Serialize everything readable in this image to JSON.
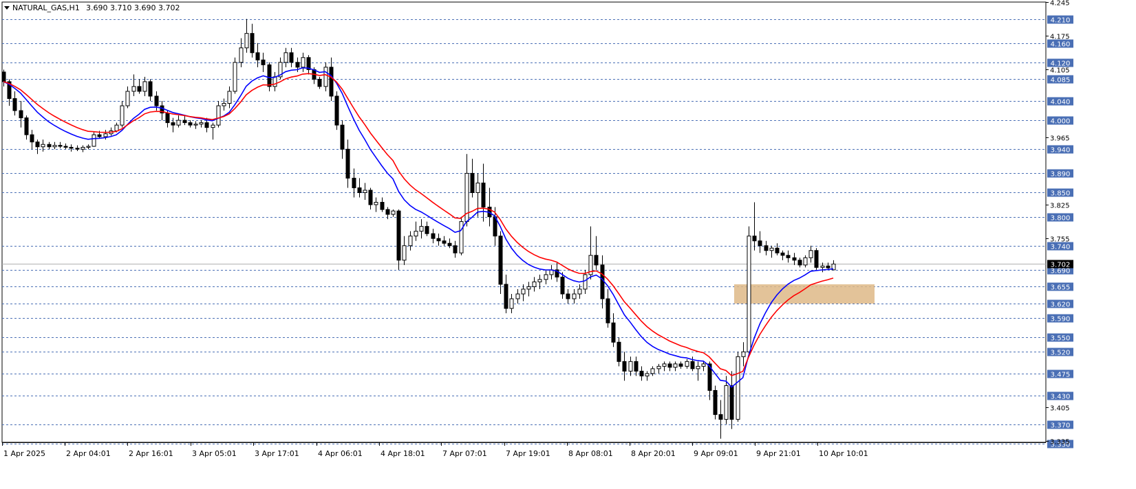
{
  "chart_data": {
    "type": "candlestick",
    "header": {
      "symbol": "NATURAL_GAS,H1",
      "ohlc": "3.690 3.710 3.690 3.702"
    },
    "current_price": "3.702",
    "y_ticks": [
      "4.245",
      "4.175",
      "4.105",
      "3.965",
      "3.825",
      "3.755",
      "3.405",
      "3.335"
    ],
    "level_lines": [
      "4.210",
      "4.160",
      "4.120",
      "4.085",
      "4.040",
      "4.000",
      "3.940",
      "3.890",
      "3.850",
      "3.800",
      "3.740",
      "3.690",
      "3.655",
      "3.620",
      "3.590",
      "3.550",
      "3.520",
      "3.475",
      "3.430",
      "3.370",
      "3.330"
    ],
    "x_labels": [
      "1 Apr 2025",
      "2 Apr 04:01",
      "2 Apr 16:01",
      "3 Apr 05:01",
      "3 Apr 17:01",
      "4 Apr 06:01",
      "4 Apr 18:01",
      "7 Apr 07:01",
      "7 Apr 19:01",
      "8 Apr 08:01",
      "8 Apr 20:01",
      "9 Apr 09:01",
      "9 Apr 21:01",
      "10 Apr 10:01"
    ],
    "zone": {
      "low": 3.62,
      "high": 3.66,
      "color": "#deb887"
    },
    "colors": {
      "blue_ma": "#0000ff",
      "red_ma": "#ff0000",
      "grid": "#4a6fb5",
      "candle": "#000000"
    },
    "ohlc_series": [
      [
        4.1,
        4.105,
        4.07,
        4.08
      ],
      [
        4.08,
        4.085,
        4.03,
        4.045
      ],
      [
        4.045,
        4.06,
        4.01,
        4.02
      ],
      [
        4.02,
        4.04,
        3.985,
        4.005
      ],
      [
        4.005,
        4.01,
        3.96,
        3.97
      ],
      [
        3.97,
        3.98,
        3.94,
        3.955
      ],
      [
        3.955,
        3.96,
        3.93,
        3.945
      ],
      [
        3.945,
        3.96,
        3.935,
        3.95
      ],
      [
        3.95,
        3.955,
        3.94,
        3.945
      ],
      [
        3.945,
        3.955,
        3.94,
        3.948
      ],
      [
        3.948,
        3.955,
        3.942,
        3.946
      ],
      [
        3.946,
        3.952,
        3.94,
        3.944
      ],
      [
        3.944,
        3.95,
        3.935,
        3.942
      ],
      [
        3.942,
        3.948,
        3.936,
        3.94
      ],
      [
        3.94,
        3.948,
        3.934,
        3.944
      ],
      [
        3.944,
        3.95,
        3.94,
        3.946
      ],
      [
        3.946,
        3.975,
        3.945,
        3.97
      ],
      [
        3.97,
        3.978,
        3.962,
        3.966
      ],
      [
        3.966,
        3.98,
        3.96,
        3.972
      ],
      [
        3.972,
        3.985,
        3.968,
        3.978
      ],
      [
        3.978,
        3.995,
        3.975,
        3.99
      ],
      [
        3.99,
        4.04,
        3.985,
        4.03
      ],
      [
        4.03,
        4.07,
        4.025,
        4.06
      ],
      [
        4.06,
        4.095,
        4.05,
        4.07
      ],
      [
        4.07,
        4.085,
        4.055,
        4.06
      ],
      [
        4.06,
        4.09,
        4.05,
        4.08
      ],
      [
        4.08,
        4.085,
        4.04,
        4.05
      ],
      [
        4.05,
        4.06,
        4.02,
        4.03
      ],
      [
        4.03,
        4.04,
        4.0,
        4.015
      ],
      [
        4.015,
        4.02,
        3.985,
        3.995
      ],
      [
        3.995,
        4.005,
        3.975,
        3.99
      ],
      [
        3.99,
        4.01,
        3.985,
        4.0
      ],
      [
        4.0,
        4.01,
        3.99,
        3.995
      ],
      [
        3.995,
        4.0,
        3.985,
        3.99
      ],
      [
        3.99,
        3.998,
        3.982,
        3.992
      ],
      [
        3.992,
        4.0,
        3.985,
        3.995
      ],
      [
        3.995,
        4.005,
        3.975,
        3.985
      ],
      [
        3.985,
        3.995,
        3.96,
        3.99
      ],
      [
        3.99,
        4.04,
        3.985,
        4.03
      ],
      [
        4.03,
        4.045,
        4.02,
        4.035
      ],
      [
        4.035,
        4.07,
        4.025,
        4.06
      ],
      [
        4.06,
        4.13,
        4.055,
        4.12
      ],
      [
        4.12,
        4.17,
        4.11,
        4.15
      ],
      [
        4.15,
        4.21,
        4.14,
        4.18
      ],
      [
        4.18,
        4.2,
        4.13,
        4.14
      ],
      [
        4.14,
        4.16,
        4.11,
        4.125
      ],
      [
        4.125,
        4.14,
        4.1,
        4.115
      ],
      [
        4.115,
        4.12,
        4.06,
        4.07
      ],
      [
        4.07,
        4.1,
        4.06,
        4.09
      ],
      [
        4.09,
        4.13,
        4.085,
        4.12
      ],
      [
        4.12,
        4.15,
        4.11,
        4.14
      ],
      [
        4.14,
        4.15,
        4.11,
        4.12
      ],
      [
        4.12,
        4.13,
        4.1,
        4.11
      ],
      [
        4.11,
        4.14,
        4.1,
        4.13
      ],
      [
        4.13,
        4.135,
        4.095,
        4.105
      ],
      [
        4.105,
        4.11,
        4.075,
        4.085
      ],
      [
        4.085,
        4.09,
        4.065,
        4.07
      ],
      [
        4.07,
        4.12,
        4.06,
        4.11
      ],
      [
        4.11,
        4.13,
        4.04,
        4.05
      ],
      [
        4.05,
        4.06,
        3.98,
        3.99
      ],
      [
        3.99,
        4.0,
        3.92,
        3.94
      ],
      [
        3.94,
        3.96,
        3.86,
        3.88
      ],
      [
        3.88,
        3.9,
        3.84,
        3.86
      ],
      [
        3.86,
        3.88,
        3.84,
        3.85
      ],
      [
        3.85,
        3.87,
        3.835,
        3.855
      ],
      [
        3.855,
        3.86,
        3.815,
        3.825
      ],
      [
        3.825,
        3.84,
        3.81,
        3.83
      ],
      [
        3.83,
        3.84,
        3.81,
        3.815
      ],
      [
        3.815,
        3.82,
        3.795,
        3.805
      ],
      [
        3.805,
        3.815,
        3.8,
        3.812
      ],
      [
        3.812,
        3.815,
        3.69,
        3.71
      ],
      [
        3.71,
        3.76,
        3.7,
        3.74
      ],
      [
        3.74,
        3.77,
        3.73,
        3.76
      ],
      [
        3.76,
        3.79,
        3.75,
        3.77
      ],
      [
        3.77,
        3.795,
        3.755,
        3.78
      ],
      [
        3.78,
        3.79,
        3.76,
        3.765
      ],
      [
        3.765,
        3.775,
        3.745,
        3.755
      ],
      [
        3.755,
        3.765,
        3.74,
        3.75
      ],
      [
        3.75,
        3.76,
        3.74,
        3.745
      ],
      [
        3.745,
        3.755,
        3.735,
        3.74
      ],
      [
        3.74,
        3.75,
        3.715,
        3.725
      ],
      [
        3.725,
        3.8,
        3.72,
        3.79
      ],
      [
        3.79,
        3.93,
        3.78,
        3.89
      ],
      [
        3.89,
        3.92,
        3.84,
        3.85
      ],
      [
        3.85,
        3.89,
        3.8,
        3.87
      ],
      [
        3.87,
        3.91,
        3.79,
        3.82
      ],
      [
        3.82,
        3.86,
        3.78,
        3.8
      ],
      [
        3.8,
        3.82,
        3.74,
        3.76
      ],
      [
        3.76,
        3.77,
        3.64,
        3.66
      ],
      [
        3.66,
        3.68,
        3.6,
        3.61
      ],
      [
        3.61,
        3.64,
        3.6,
        3.63
      ],
      [
        3.63,
        3.65,
        3.62,
        3.64
      ],
      [
        3.64,
        3.66,
        3.625,
        3.65
      ],
      [
        3.65,
        3.665,
        3.635,
        3.655
      ],
      [
        3.655,
        3.675,
        3.645,
        3.665
      ],
      [
        3.665,
        3.68,
        3.65,
        3.67
      ],
      [
        3.67,
        3.69,
        3.66,
        3.68
      ],
      [
        3.68,
        3.7,
        3.67,
        3.69
      ],
      [
        3.69,
        3.705,
        3.665,
        3.675
      ],
      [
        3.675,
        3.685,
        3.63,
        3.64
      ],
      [
        3.64,
        3.65,
        3.62,
        3.63
      ],
      [
        3.63,
        3.65,
        3.62,
        3.64
      ],
      [
        3.64,
        3.66,
        3.63,
        3.65
      ],
      [
        3.65,
        3.69,
        3.64,
        3.68
      ],
      [
        3.68,
        3.78,
        3.67,
        3.72
      ],
      [
        3.72,
        3.76,
        3.69,
        3.7
      ],
      [
        3.7,
        3.72,
        3.61,
        3.63
      ],
      [
        3.63,
        3.65,
        3.57,
        3.58
      ],
      [
        3.58,
        3.6,
        3.53,
        3.54
      ],
      [
        3.54,
        3.55,
        3.49,
        3.5
      ],
      [
        3.5,
        3.52,
        3.46,
        3.48
      ],
      [
        3.48,
        3.51,
        3.47,
        3.5
      ],
      [
        3.5,
        3.51,
        3.47,
        3.48
      ],
      [
        3.48,
        3.49,
        3.46,
        3.47
      ],
      [
        3.47,
        3.48,
        3.46,
        3.475
      ],
      [
        3.475,
        3.49,
        3.47,
        3.485
      ],
      [
        3.485,
        3.495,
        3.475,
        3.49
      ],
      [
        3.49,
        3.5,
        3.48,
        3.495
      ],
      [
        3.495,
        3.5,
        3.48,
        3.488
      ],
      [
        3.488,
        3.5,
        3.48,
        3.495
      ],
      [
        3.495,
        3.5,
        3.485,
        3.49
      ],
      [
        3.49,
        3.505,
        3.485,
        3.5
      ],
      [
        3.5,
        3.51,
        3.48,
        3.485
      ],
      [
        3.485,
        3.5,
        3.46,
        3.49
      ],
      [
        3.49,
        3.5,
        3.48,
        3.495
      ],
      [
        3.495,
        3.5,
        3.42,
        3.44
      ],
      [
        3.44,
        3.45,
        3.38,
        3.39
      ],
      [
        3.39,
        3.42,
        3.34,
        3.38
      ],
      [
        3.38,
        3.47,
        3.37,
        3.45
      ],
      [
        3.45,
        3.48,
        3.36,
        3.38
      ],
      [
        3.38,
        3.52,
        3.375,
        3.51
      ],
      [
        3.51,
        3.54,
        3.49,
        3.52
      ],
      [
        3.52,
        3.78,
        3.51,
        3.76
      ],
      [
        3.76,
        3.83,
        3.73,
        3.75
      ],
      [
        3.75,
        3.77,
        3.725,
        3.74
      ],
      [
        3.74,
        3.75,
        3.72,
        3.73
      ],
      [
        3.73,
        3.74,
        3.715,
        3.735
      ],
      [
        3.735,
        3.745,
        3.72,
        3.725
      ],
      [
        3.725,
        3.73,
        3.71,
        3.72
      ],
      [
        3.72,
        3.73,
        3.705,
        3.715
      ],
      [
        3.715,
        3.725,
        3.7,
        3.71
      ],
      [
        3.71,
        3.715,
        3.695,
        3.7
      ],
      [
        3.7,
        3.72,
        3.695,
        3.715
      ],
      [
        3.715,
        3.74,
        3.705,
        3.73
      ],
      [
        3.73,
        3.735,
        3.69,
        3.695
      ],
      [
        3.695,
        3.705,
        3.685,
        3.698
      ],
      [
        3.698,
        3.705,
        3.69,
        3.694
      ],
      [
        3.69,
        3.71,
        3.69,
        3.702
      ]
    ]
  }
}
